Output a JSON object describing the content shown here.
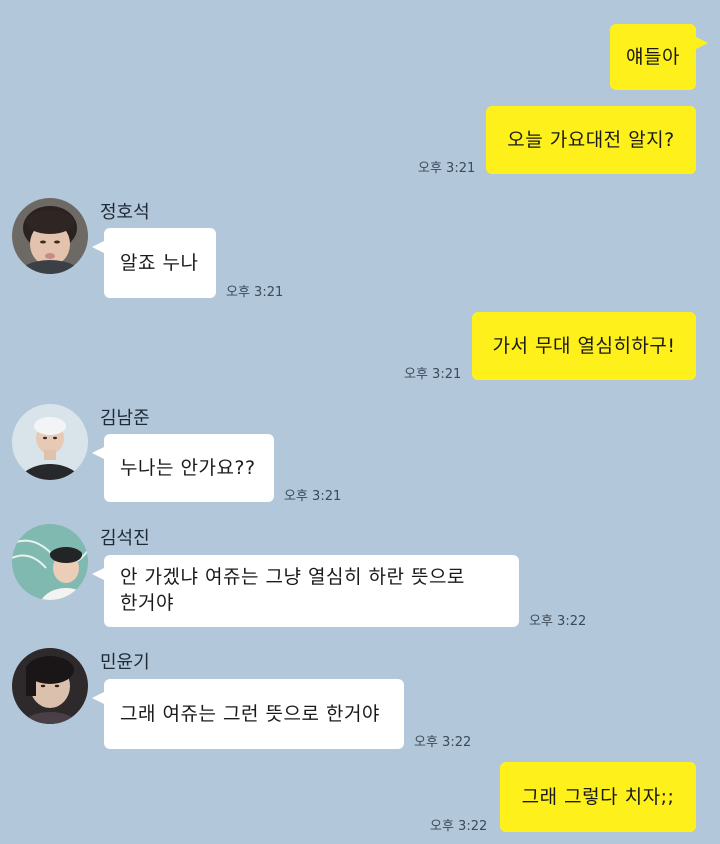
{
  "messages": [
    {
      "side": "mine",
      "text": "얘들아",
      "time": ""
    },
    {
      "side": "mine",
      "text": "오늘 가요대전 알지?",
      "time": "오후 3:21"
    },
    {
      "side": "theirs",
      "sender": "정호석",
      "text": "알죠 누나",
      "time": "오후 3:21"
    },
    {
      "side": "mine",
      "text": "가서 무대 열심히하구!",
      "time": "오후 3:21"
    },
    {
      "side": "theirs",
      "sender": "김남준",
      "text": "누나는 안가요??",
      "time": "오후 3:21"
    },
    {
      "side": "theirs",
      "sender": "김석진",
      "text": "안 가겠냐 여쥬는 그냥 열심히 하란 뜻으로\n한거야",
      "time": "오후 3:22"
    },
    {
      "side": "theirs",
      "sender": "민윤기",
      "text": "그래 여쥬는 그런 뜻으로 한거야",
      "time": "오후 3:22"
    },
    {
      "side": "mine",
      "text": "그래 그렇다 치자;;",
      "time": "오후 3:22"
    }
  ],
  "colors": {
    "background": "#b2c7da",
    "mine_bubble": "#fef01b",
    "theirs_bubble": "#ffffff"
  }
}
